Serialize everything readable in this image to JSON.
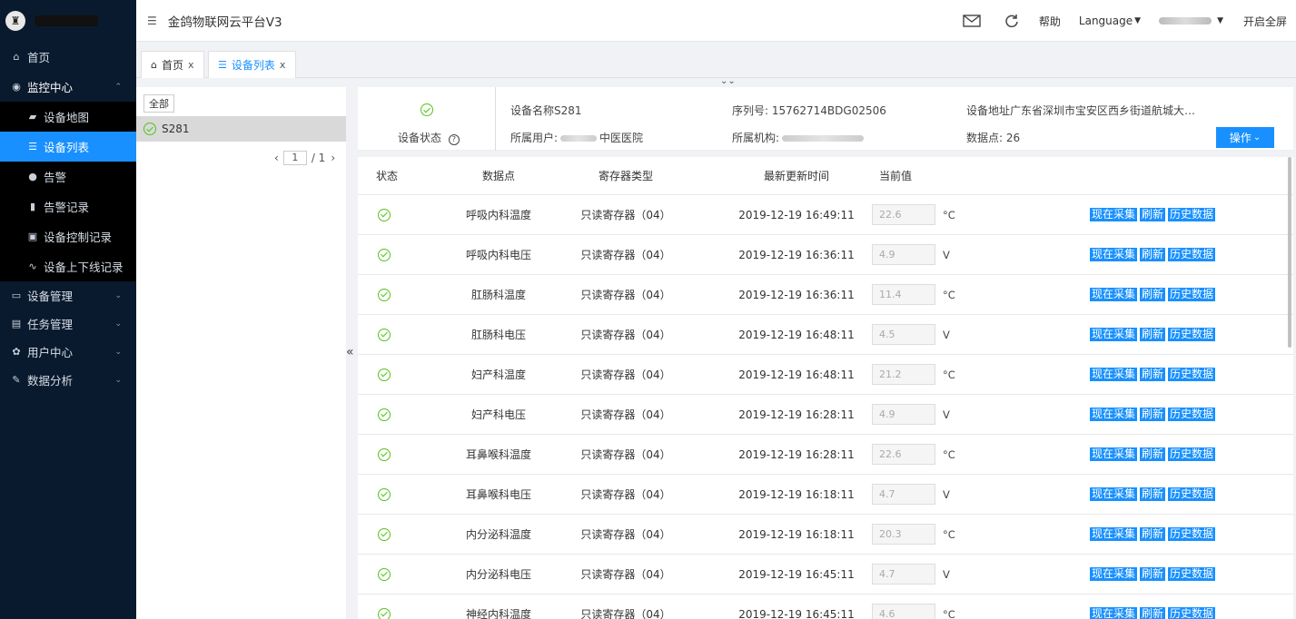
{
  "header": {
    "title": "金鸽物联网云平台V3",
    "help": "帮助",
    "language": "Language",
    "user_caret": "▾",
    "fullscreen": "开启全屏"
  },
  "sidebar": {
    "logo_glyph": "♜",
    "items": [
      {
        "label": "首页",
        "icon": "home-icon"
      },
      {
        "label": "监控中心",
        "icon": "location-icon"
      },
      {
        "label": "设备地图",
        "icon": "map-icon"
      },
      {
        "label": "设备列表",
        "icon": "list-icon"
      },
      {
        "label": "告警",
        "icon": "alert-icon"
      },
      {
        "label": "告警记录",
        "icon": "file-icon"
      },
      {
        "label": "设备控制记录",
        "icon": "control-icon"
      },
      {
        "label": "设备上下线记录",
        "icon": "pulse-icon"
      },
      {
        "label": "设备管理",
        "icon": "monitor-icon"
      },
      {
        "label": "任务管理",
        "icon": "task-icon"
      },
      {
        "label": "用户中心",
        "icon": "gear-icon"
      },
      {
        "label": "数据分析",
        "icon": "edit-icon"
      }
    ]
  },
  "tabs": [
    {
      "label": "首页",
      "close": "x"
    },
    {
      "label": "设备列表",
      "close": "x"
    }
  ],
  "tree": {
    "all_label": "全部",
    "device": "S281",
    "page_current": "1",
    "page_total": "/ 1"
  },
  "device_info": {
    "status_label": "设备状态",
    "name": "设备名称S281",
    "owner_prefix": "所属用户:",
    "owner_suffix": "中医医院",
    "serial": "序列号: 15762714BDG02506",
    "org_prefix": "所属机构:",
    "address": "设备地址广东省深圳市宝安区西乡街道航城大…",
    "points": "数据点: 26",
    "operate": "操作"
  },
  "table": {
    "headers": {
      "status": "状态",
      "point": "数据点",
      "type": "寄存器类型",
      "time": "最新更新时间",
      "value": "当前值"
    },
    "actions": [
      "现在采集",
      "刷新",
      "历史数据"
    ],
    "rows": [
      {
        "point": "呼吸内科温度",
        "type": "只读寄存器（04）",
        "time": "2019-12-19 16:49:11",
        "value": "22.6",
        "unit": "°C"
      },
      {
        "point": "呼吸内科电压",
        "type": "只读寄存器（04）",
        "time": "2019-12-19 16:36:11",
        "value": "4.9",
        "unit": "V"
      },
      {
        "point": "肛肠科温度",
        "type": "只读寄存器（04）",
        "time": "2019-12-19 16:36:11",
        "value": "11.4",
        "unit": "°C"
      },
      {
        "point": "肛肠科电压",
        "type": "只读寄存器（04）",
        "time": "2019-12-19 16:48:11",
        "value": "4.5",
        "unit": "V"
      },
      {
        "point": "妇产科温度",
        "type": "只读寄存器（04）",
        "time": "2019-12-19 16:48:11",
        "value": "21.2",
        "unit": "°C"
      },
      {
        "point": "妇产科电压",
        "type": "只读寄存器（04）",
        "time": "2019-12-19 16:28:11",
        "value": "4.9",
        "unit": "V"
      },
      {
        "point": "耳鼻喉科温度",
        "type": "只读寄存器（04）",
        "time": "2019-12-19 16:28:11",
        "value": "22.6",
        "unit": "°C"
      },
      {
        "point": "耳鼻喉科电压",
        "type": "只读寄存器（04）",
        "time": "2019-12-19 16:18:11",
        "value": "4.7",
        "unit": "V"
      },
      {
        "point": "内分泌科温度",
        "type": "只读寄存器（04）",
        "time": "2019-12-19 16:18:11",
        "value": "20.3",
        "unit": "°C"
      },
      {
        "point": "内分泌科电压",
        "type": "只读寄存器（04）",
        "time": "2019-12-19 16:45:11",
        "value": "4.7",
        "unit": "V"
      },
      {
        "point": "神经内科温度",
        "type": "只读寄存器（04）",
        "time": "2019-12-19 16:45:11",
        "value": "4.6",
        "unit": "°C"
      }
    ]
  }
}
